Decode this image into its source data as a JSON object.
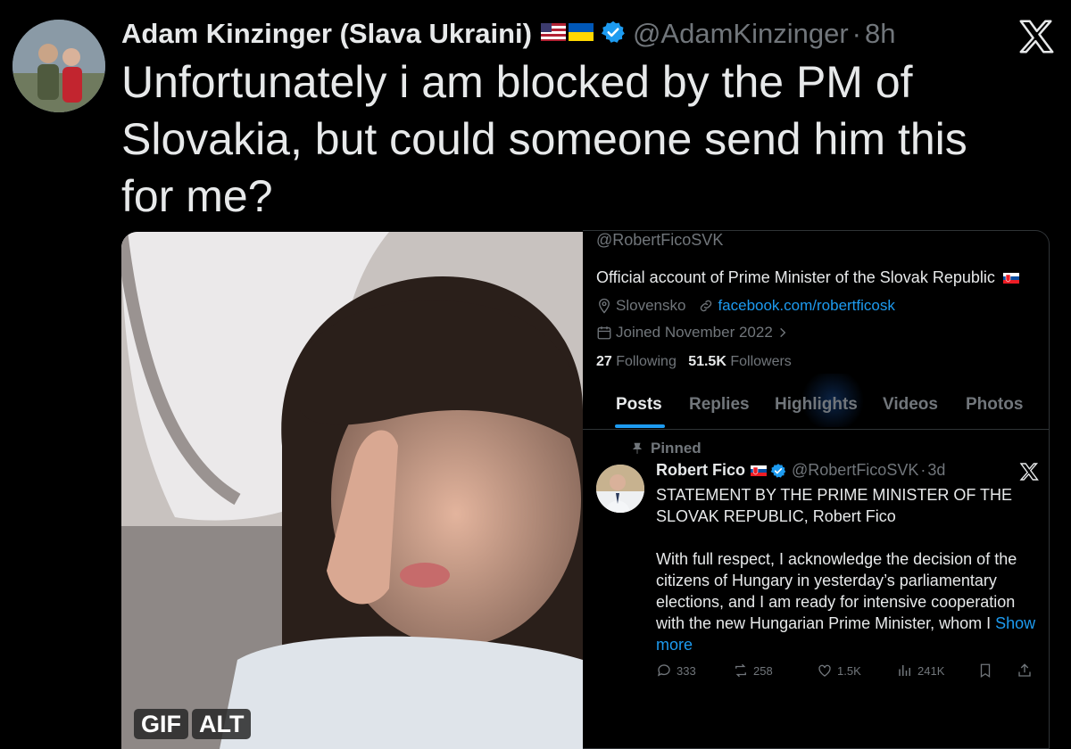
{
  "tweet": {
    "author_name": "Adam Kinzinger (Slava Ukraini)",
    "handle": "@AdamKinzinger",
    "separator": "·",
    "time": "8h",
    "text": "Unfortunately i am blocked by the PM of Slovakia, but could someone send him this for me?",
    "media_badges": {
      "gif": "GIF",
      "alt": "ALT"
    }
  },
  "profile_card": {
    "handle": "@RobertFicoSVK",
    "bio": "Official account of Prime Minister of the Slovak Republic",
    "location": "Slovensko",
    "link": "facebook.com/robertficosk",
    "joined": "Joined November 2022",
    "following_count": "27",
    "following_label": "Following",
    "followers_count": "51.5K",
    "followers_label": "Followers",
    "tabs": [
      "Posts",
      "Replies",
      "Highlights",
      "Videos",
      "Photos"
    ],
    "active_tab": "Posts",
    "pinned_label": "Pinned",
    "post": {
      "name": "Robert Fico",
      "handle": "@RobertFicoSVK",
      "separator": "·",
      "time": "3d",
      "body": "STATEMENT BY THE PRIME MINISTER OF THE SLOVAK REPUBLIC, Robert Fico\n\nWith full respect, I acknowledge the decision of the citizens of Hungary in yesterday’s parliamentary elections, and I am ready for intensive cooperation with the new Hungarian Prime Minister, whom I ",
      "show_more": "Show more",
      "replies": "333",
      "reposts": "258",
      "likes": "1.5K",
      "views": "241K"
    }
  },
  "colors": {
    "accent": "#1d9bf0",
    "muted": "#71767b",
    "text": "#e7e9ea",
    "background": "#000000"
  },
  "icons": [
    "verified-badge-icon",
    "us-flag-icon",
    "ukraine-flag-icon",
    "slovakia-flag-icon",
    "x-logo-icon",
    "location-pin-icon",
    "link-icon",
    "calendar-icon",
    "chevron-right-icon",
    "pin-icon",
    "reply-icon",
    "repost-icon",
    "like-icon",
    "views-icon",
    "bookmark-icon",
    "share-icon"
  ]
}
